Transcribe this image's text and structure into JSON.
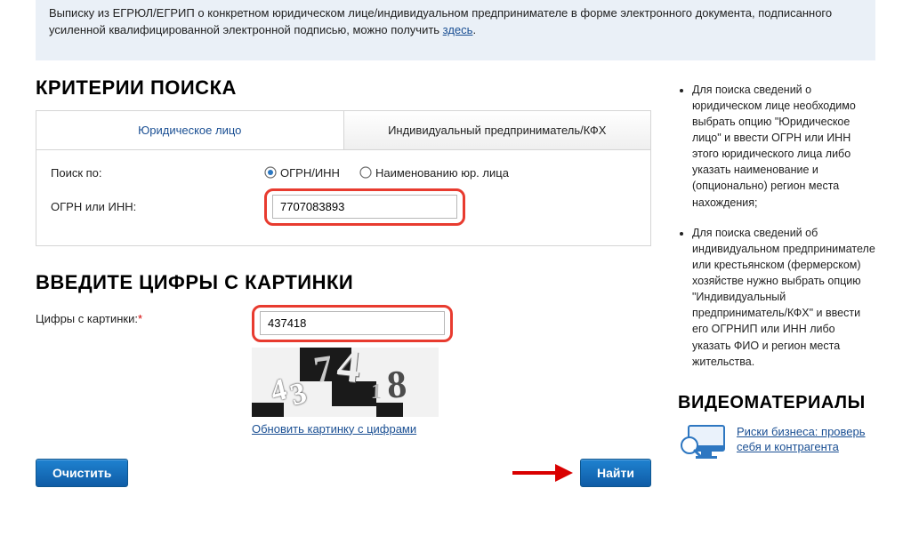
{
  "notice": {
    "text_before_link": "Выписку из ЕГРЮЛ/ЕГРИП о конкретном юридическом лице/индивидуальном предпринимателе в форме электронного документа, подписанного усиленной квалифицированной электронной подписью, можно получить ",
    "link_text": "здесь",
    "text_after_link": "."
  },
  "search": {
    "criteria_heading": "КРИТЕРИИ ПОИСКА",
    "tab_legal": "Юридическое лицо",
    "tab_individual": "Индивидуальный предприниматель/КФХ",
    "label_search_by": "Поиск по:",
    "radio_ogrn": "ОГРН/ИНН",
    "radio_name": "Наименованию юр. лица",
    "label_ogrn_inn": "ОГРН или ИНН:",
    "ogrn_value": "7707083893"
  },
  "captcha": {
    "heading": "ВВЕДИТЕ ЦИФРЫ С КАРТИНКИ",
    "label": "Цифры с картинки:",
    "required_mark": "*",
    "value": "437418",
    "refresh_link": "Обновить картинку с цифрами",
    "image_digits": "437418"
  },
  "buttons": {
    "clear": "Очистить",
    "find": "Найти"
  },
  "help": {
    "item1": "Для поиска сведений о юридическом лице необходимо выбрать опцию \"Юридическое лицо\" и ввести ОГРН или ИНН этого юридического лица либо указать наименование и (опционально) регион места нахождения;",
    "item2": "Для поиска сведений об индивидуальном предпринимателе или крестьянском (фермерском) хозяйстве нужно выбрать опцию \"Индивидуальный предприниматель/КФХ\" и ввести его ОГРНИП или ИНН либо указать ФИО и регион места жительства."
  },
  "video": {
    "heading": "ВИДЕОМАТЕРИАЛЫ",
    "item1": "Риски бизнеса: проверь себя и контрагента"
  }
}
